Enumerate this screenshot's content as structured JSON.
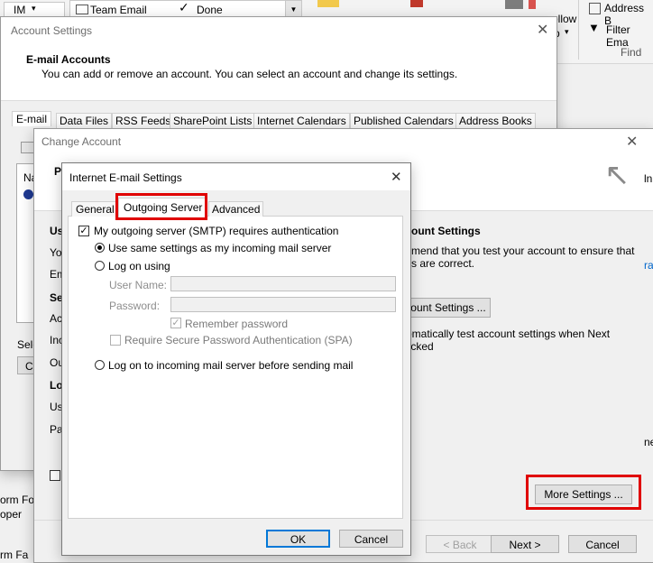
{
  "ribbon": {
    "im_label": "IM",
    "team_email": "Team Email",
    "done": "Done",
    "follow_up": "ollow",
    "follow_up_sub": "p",
    "address_book": "Address B",
    "filter_email": "Filter Ema",
    "find_group": "Find"
  },
  "background_left": {
    "line1": "orm Fo...",
    "line2": "oper"
  },
  "account_settings": {
    "title": "Account Settings",
    "heading": "E-mail Accounts",
    "description": "You can add or remove an account. You can select an account and change its settings.",
    "tabs": [
      "E-mail",
      "Data Files",
      "RSS Feeds",
      "SharePoint Lists",
      "Internet Calendars",
      "Published Calendars",
      "Address Books"
    ],
    "partial_labels": [
      "Na",
      "Sele",
      "Cl"
    ]
  },
  "change_account": {
    "title": "Change Account",
    "partial_labels": [
      "Po",
      "Us",
      "You",
      "Em",
      "Ser",
      "Acc",
      "Inc",
      "Ou",
      "Lo",
      "Us",
      "Pas"
    ],
    "right_heading": "ount Settings",
    "right_desc1": "mend that you test your account to ensure that",
    "right_desc2": "s are correct.",
    "right_button": "ount Settings ...",
    "auto_test1": "omatically test account settings when Next",
    "auto_test2": "licked",
    "more_settings": "More Settings ...",
    "back": "< Back",
    "next": "Next >",
    "cancel": "Cancel",
    "edge_text": "ln",
    "edge_text2": "ra",
    "edge_text3": "ne"
  },
  "internet_settings": {
    "title": "Internet E-mail Settings",
    "tabs": {
      "general": "General",
      "outgoing": "Outgoing Server",
      "advanced": "Advanced"
    },
    "smtp_auth": "My outgoing server (SMTP) requires authentication",
    "same_settings": "Use same settings as my incoming mail server",
    "log_on_using": "Log on using",
    "user_name_label": "User Name:",
    "password_label": "Password:",
    "remember_password": "Remember password",
    "spa": "Require Secure Password Authentication (SPA)",
    "log_on_incoming": "Log on to incoming mail server before sending mail",
    "ok": "OK",
    "cancel": "Cancel"
  }
}
